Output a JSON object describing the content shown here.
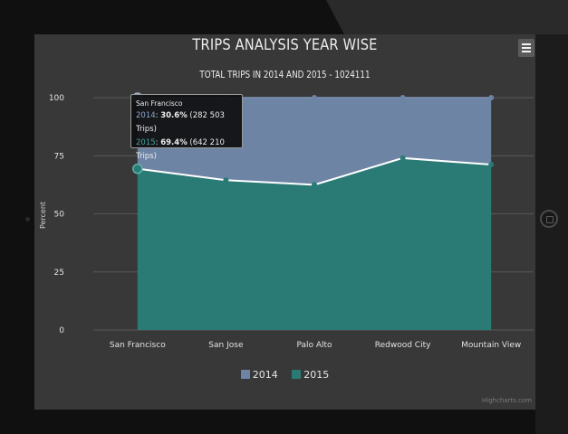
{
  "chart_data": {
    "type": "area",
    "stacking": "percent",
    "title": "TRIPS ANALYSIS YEAR WISE",
    "subtitle": "TOTAL TRIPS IN 2014 AND 2015 - 1024111",
    "ylabel": "Percent",
    "ylim": [
      0,
      100
    ],
    "yticks": [
      "0",
      "25",
      "50",
      "75",
      "100"
    ],
    "categories": [
      "San Francisco",
      "San Jose",
      "Palo Alto",
      "Redwood City",
      "Mountain View"
    ],
    "series": [
      {
        "name": "2014",
        "color": "#6d84a5",
        "values": [
          30.6,
          35.5,
          37.5,
          26.0,
          28.8
        ]
      },
      {
        "name": "2015",
        "color": "#2a7a76",
        "values": [
          69.4,
          64.5,
          62.5,
          74.0,
          71.2
        ]
      }
    ],
    "legend_position": "bottom",
    "grid": true
  },
  "tooltip": {
    "category": "San Francisco",
    "line1_name": "2014",
    "line1_pct": "30.6%",
    "line1_trips": "(282 503 Trips)",
    "line2_name": "2015",
    "line2_pct": "69.4%",
    "line2_trips": "(642 210 Trips)"
  },
  "credits": "Highcharts.com",
  "colors": {
    "bezel": "#101010",
    "screen": "#383838",
    "grid": "#585858"
  }
}
